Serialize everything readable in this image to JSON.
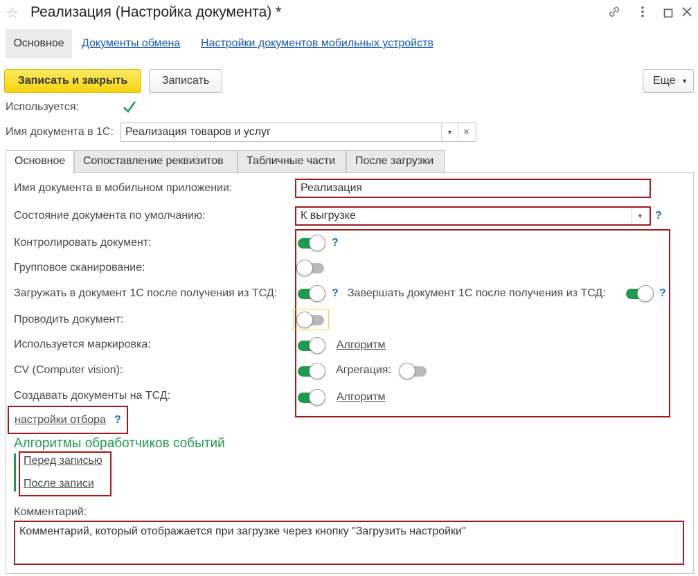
{
  "window": {
    "title": "Реализация (Настройка документа) *",
    "icons": [
      "star-icon",
      "link-icon",
      "more-vertical-icon",
      "maximize-icon",
      "close-icon"
    ]
  },
  "nav_tabs": [
    {
      "label": "Основное"
    },
    {
      "label": "Документы обмена"
    },
    {
      "label": "Настройки документов мобильных устройств"
    }
  ],
  "toolbar": {
    "save_close": "Записать и закрыть",
    "save": "Записать",
    "more": "Еще"
  },
  "used": {
    "label": "Используется:",
    "checked": true
  },
  "doc_name_1c": {
    "label": "Имя документа в 1С:",
    "value": "Реализация товаров и услуг"
  },
  "form_tabs": [
    {
      "label": "Основное"
    },
    {
      "label": "Сопоставление реквизитов"
    },
    {
      "label": "Табличные части"
    },
    {
      "label": "После загрузки"
    }
  ],
  "fields": {
    "mobile_name": {
      "label": "Имя документа в мобильном приложении:",
      "value": "Реализация"
    },
    "default_state": {
      "label": "Состояние документа по умолчанию:",
      "value": "К выгрузке",
      "help": "?"
    },
    "control_doc": {
      "label": "Контролировать документ:",
      "on": true,
      "help": "?"
    },
    "group_scan": {
      "label": "Групповое сканирование:",
      "on": false
    },
    "load_after": {
      "label": "Загружать в документ 1С после получения из ТСД:",
      "on": true,
      "help": "?"
    },
    "finish_after": {
      "label": "Завершать документ 1С после получения из ТСД:",
      "on": true,
      "help": "?"
    },
    "post_doc": {
      "label": "Проводить документ:",
      "on": false
    },
    "marking": {
      "label": "Используется маркировка:",
      "on": true,
      "link": "Алгоритм"
    },
    "cv": {
      "label": "CV (Computer vision):",
      "on": true
    },
    "aggregation": {
      "label": "Агрегация:",
      "on": false
    },
    "create_tsd": {
      "label": "Создавать документы на ТСД:",
      "on": true,
      "link": "Алгоритм"
    }
  },
  "filter_link": {
    "label": "настройки отбора",
    "help": "?"
  },
  "handlers": {
    "title": "Алгоритмы обработчиков событий",
    "before": "Перед записью",
    "after": "После записи"
  },
  "comment": {
    "label": "Комментарий:",
    "value": "Комментарий, который отображается при загрузке через кнопку \"Загрузить настройки\""
  },
  "colors": {
    "accent_green": "#1f9a4f",
    "highlight_red": "#a01c1c",
    "primary_yellow": "#f5d50f",
    "link_blue": "#1a5ab0"
  }
}
